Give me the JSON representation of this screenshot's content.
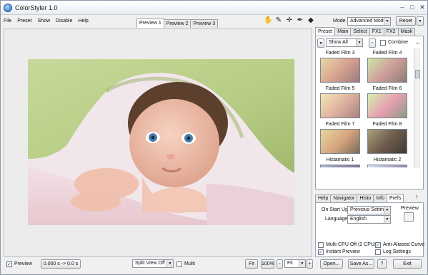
{
  "window": {
    "title": "ColorStyler 1.0",
    "min": "–",
    "max": "□",
    "close": "✕"
  },
  "menu": [
    "File",
    "Preset",
    "Show",
    "Disable",
    "Help"
  ],
  "preview_tabs": [
    "Preview 1",
    "Preview 2",
    "Preview 3"
  ],
  "tools": [
    "✋",
    "✎",
    "✛",
    "✒",
    "◆"
  ],
  "mode": {
    "label": "Mode",
    "value": "Advanced Mode",
    "reset": "Reset"
  },
  "right_tabs": [
    "Preset",
    "Main",
    "Select",
    "FX1",
    "FX2",
    "Mask"
  ],
  "preset_toolbar": {
    "filter_value": "Show All",
    "minus": "-",
    "combine": "Combine",
    "arrow": "←"
  },
  "presets": [
    {
      "name": "Faded Film 3",
      "grad": "linear-gradient(135deg,#e9d7a9,#d6a38f 50%,#9c7a7f)"
    },
    {
      "name": "Faded Film 4",
      "grad": "linear-gradient(135deg,#cfe5a8,#cf9e9b 50%,#8c7d70)"
    },
    {
      "name": "Faded Film 5",
      "grad": "linear-gradient(135deg,#f2e7b5,#e0b3a0 50%,#a88280)"
    },
    {
      "name": "Faded Film 6",
      "grad": "linear-gradient(135deg,#d7efb2,#e7a0b0 50%,#8f9a86)"
    },
    {
      "name": "Faded Film 7",
      "grad": "linear-gradient(135deg,#e8d6a0,#d8a77f 50%,#7c6a58)"
    },
    {
      "name": "Faded Film 8",
      "grad": "linear-gradient(135deg,#a9a27b,#6f5c4d 50%,#3e3a33)"
    },
    {
      "name": "Histamatic 1",
      "grad": "linear-gradient(135deg,#a6b8d6,#8a7f9e 50%,#4e4f6c)"
    },
    {
      "name": "Histamatic 2",
      "grad": "linear-gradient(135deg,#d3e2ff,#9f9ab6 50%,#5a5a72)"
    }
  ],
  "lower_tabs": [
    "Help",
    "Navigator",
    "Histo",
    "Info",
    "Prefs"
  ],
  "lower_arrow": "↑",
  "prefs": {
    "on_start_up_label": "On Start Up",
    "on_start_up_value": "Previous Settings",
    "language_label": "Language",
    "language_value": "English",
    "preview_label": "Preview",
    "multicpu": "Multi-CPU Off (2 CPUs)",
    "anti_aliased": "Anti-Aliased Curve",
    "instant_preview": "Instant Preview",
    "log_settings": "Log Settings"
  },
  "status": {
    "preview_label": "Preview",
    "timing": "0.000 s -> 0.0 s",
    "split_view": "Split View Off",
    "multi": "Multi",
    "fit1": "Fit",
    "zoom": "100%",
    "minus": "-",
    "fit2": "Fit",
    "plus": "+",
    "open": "Open...",
    "save_as": "Save As...",
    "help": "?",
    "exit": "Exit"
  }
}
